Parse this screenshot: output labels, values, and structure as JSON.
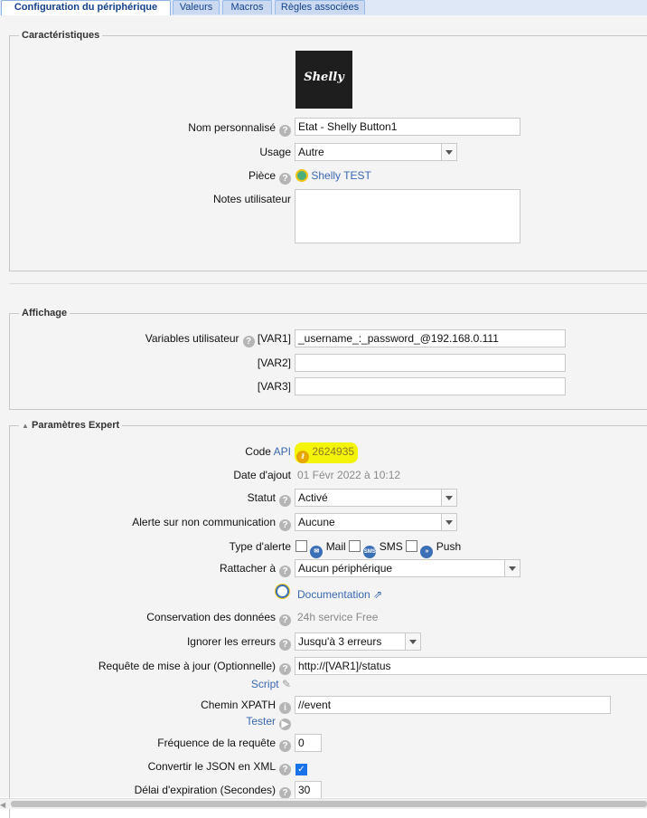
{
  "tabs": [
    {
      "label": "Configuration du périphérique",
      "active": true
    },
    {
      "label": "Valeurs",
      "active": false
    },
    {
      "label": "Macros",
      "active": false
    },
    {
      "label": "Règles associées",
      "active": false
    }
  ],
  "caracteristiques": {
    "legend": "Caractéristiques",
    "logo_text": "Shelly",
    "nom_label": "Nom personnalisé",
    "nom_value": "Etat - Shelly Button1",
    "usage_label": "Usage",
    "usage_value": "Autre",
    "piece_label": "Pièce",
    "piece_value": "Shelly TEST",
    "notes_label": "Notes utilisateur",
    "notes_value": ""
  },
  "affichage": {
    "legend": "Affichage",
    "var_label": "Variables utilisateur",
    "vars": [
      {
        "tag": "[VAR1]",
        "value": "_username_:_password_@192.168.0.111"
      },
      {
        "tag": "[VAR2]",
        "value": ""
      },
      {
        "tag": "[VAR3]",
        "value": ""
      }
    ]
  },
  "expert": {
    "legend": "Paramètres Expert",
    "code_label": "Code",
    "code_api": "API",
    "code_value": "2624935",
    "date_label": "Date d'ajout",
    "date_value": "01 Févr 2022 à 10:12",
    "statut_label": "Statut",
    "statut_value": "Activé",
    "alerte_label": "Alerte sur non communication",
    "alerte_value": "Aucune",
    "type_label": "Type d'alerte",
    "type_mail": "Mail",
    "type_sms": "SMS",
    "type_push": "Push",
    "sms_icon_text": "SMS",
    "rattacher_label": "Rattacher à",
    "rattacher_value": "Aucun périphérique",
    "doc_label": "Documentation",
    "conservation_label": "Conservation des données",
    "conservation_value": "24h service Free",
    "ignorer_label": "Ignorer les erreurs",
    "ignorer_value": "Jusqu'à 3 erreurs",
    "requete_label": "Requête de mise à jour (Optionnelle)",
    "requete_value": "http://[VAR1]/status",
    "script_label": "Script",
    "xpath_label": "Chemin XPATH",
    "xpath_value": "//event",
    "tester_label": "Tester",
    "frequence_label": "Fréquence de la requête",
    "frequence_value": "0",
    "json_label": "Convertir le JSON en XML",
    "json_checked": true,
    "delai_label": "Délai d'expiration (Secondes)",
    "delai_value": "30"
  },
  "colors": {
    "highlight": "#f4f40a",
    "link": "#3a67b0",
    "tab_text": "#15428b"
  }
}
